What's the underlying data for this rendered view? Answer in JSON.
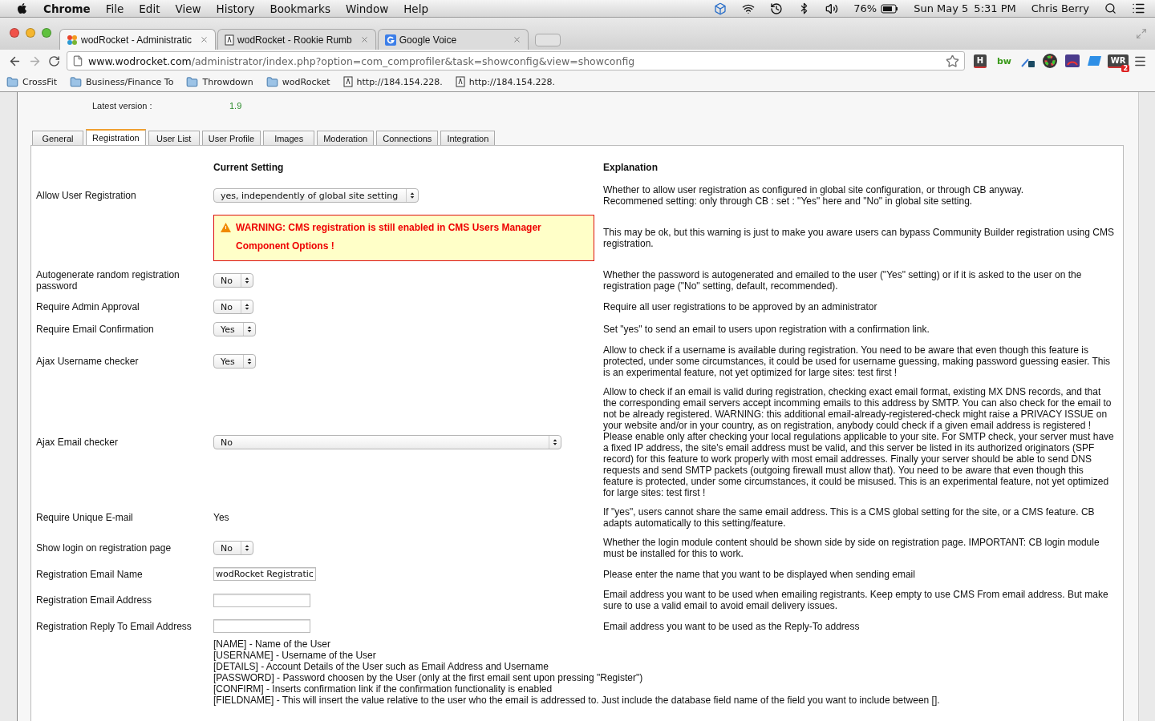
{
  "menubar": {
    "app": "Chrome",
    "menus": [
      "File",
      "Edit",
      "View",
      "History",
      "Bookmarks",
      "Window",
      "Help"
    ],
    "battery": "76%",
    "date": "Sun May 5",
    "time": "5:31 PM",
    "user": "Chris Berry"
  },
  "browser_tabs": [
    {
      "title": "wodRocket - Administratic",
      "selected": true,
      "kind": "pinwheel"
    },
    {
      "title": "wodRocket - Rookie Rumb",
      "selected": false,
      "kind": "page"
    },
    {
      "title": "Google Voice",
      "selected": false,
      "kind": "g"
    }
  ],
  "address_bar": {
    "host": "www.wodrocket.com",
    "path": "/administrator/index.php?option=com_comprofiler&task=showconfig&view=showconfig"
  },
  "extensions": [
    {
      "kind": "tile",
      "label": "H"
    },
    {
      "kind": "word",
      "label": "bw"
    },
    {
      "kind": "dropper"
    },
    {
      "kind": "ring"
    },
    {
      "kind": "gauge"
    },
    {
      "kind": "tag"
    },
    {
      "kind": "tile",
      "label": "WR",
      "badge": "2"
    }
  ],
  "bookmarks": [
    {
      "label": "CrossFit",
      "kind": "folder"
    },
    {
      "label": "Business/Finance To",
      "kind": "folder"
    },
    {
      "label": "Throwdown",
      "kind": "folder"
    },
    {
      "label": "wodRocket",
      "kind": "folder"
    },
    {
      "label": "http://184.154.228.",
      "kind": "page"
    },
    {
      "label": "http://184.154.228.",
      "kind": "page"
    }
  ],
  "version": {
    "label": "Latest version :",
    "value": "1.9"
  },
  "config_tabs": [
    {
      "label": "General",
      "selected": false
    },
    {
      "label": "Registration",
      "selected": true
    },
    {
      "label": "User List",
      "selected": false
    },
    {
      "label": "User Profile",
      "selected": false
    },
    {
      "label": "Images",
      "selected": false
    },
    {
      "label": "Moderation",
      "selected": false
    },
    {
      "label": "Connections",
      "selected": false
    },
    {
      "label": "Integration",
      "selected": false
    }
  ],
  "headings": {
    "setting": "Current Setting",
    "explanation": "Explanation"
  },
  "rows": [
    {
      "label": "Allow User Registration",
      "kind": "select",
      "value": "yes, independently of global site setting",
      "explanation": "Whether to allow user registration as configured in global site configuration, or through CB anyway.\nRecommened setting: only through CB : set : \"Yes\" here and \"No\" in global site setting."
    },
    {
      "kind": "warning",
      "value": "WARNING: CMS registration is still enabled in CMS Users Manager Component Options !",
      "explanation": "This may be ok, but this warning is just to make you aware users can bypass Community Builder registration using CMS registration."
    },
    {
      "label": "Autogenerate random registration password",
      "kind": "select",
      "value": "No",
      "explanation": "Whether the password is autogenerated and emailed to the user (\"Yes\" setting) or if it is asked to the user on the registration page (\"No\" setting, default, recommended)."
    },
    {
      "label": "Require Admin Approval",
      "kind": "select",
      "value": "No",
      "explanation": "Require all user registrations to be approved by an administrator"
    },
    {
      "label": "Require Email Confirmation",
      "kind": "select",
      "value": "Yes",
      "explanation": "Set \"yes\" to send an email to users upon registration with a confirmation link."
    },
    {
      "label": "Ajax Username checker",
      "kind": "select",
      "value": "Yes",
      "explanation": "Allow to check if a username is available during registration. You need to be aware that even though this feature is protected, under some circumstances, it could be used for username guessing, making password guessing easier. This is an experimental feature, not yet optimized for large sites: test first !"
    },
    {
      "label": "Ajax Email checker",
      "kind": "wide_select",
      "value": "No",
      "explanation": "Allow to check if an email is valid during registration, checking exact email format, existing MX DNS records, and that the corresponding email servers accept incomming emails to this address by SMTP. You can also check for the email to not be already registered. WARNING: this additional email-already-registered-check might raise a PRIVACY ISSUE on your website and/or in your country, as on registration, anybody could check if a given email address is registered ! Please enable only after checking your local regulations applicable to your site. For SMTP check, your server must have a fixed IP address, the site's email address must be valid, and this server be listed in its authorized originators (SPF record) for this feature to work properly with most email addresses. Finally your server should be able to send DNS requests and send SMTP packets (outgoing firewall must allow that). You need to be aware that even though this feature is protected, under some circumstances, it could be misused. This is an experimental feature, not yet optimized for large sites: test first !"
    },
    {
      "label": "Require Unique E-mail",
      "kind": "value",
      "value": "Yes",
      "explanation": "If \"yes\", users cannot share the same email address. This is a CMS global setting for the site, or a CMS feature. CB adapts automatically to this setting/feature."
    },
    {
      "label": "Show login on registration page",
      "kind": "select",
      "value": "No",
      "explanation": "Whether the login module content should be shown side by side on registration page. IMPORTANT: CB login module must be installed for this to work."
    },
    {
      "label": "Registration Email Name",
      "kind": "input",
      "value": "wodRocket Registratic",
      "explanation": "Please enter the name that you want to be displayed when sending email"
    },
    {
      "label": "Registration Email Address",
      "kind": "input",
      "explanation": "Email address you want to be used when emailing registrants. Keep empty to use CMS From email address. But make sure to use a valid email to avoid email delivery issues."
    },
    {
      "label": "Registration Reply To Email Address",
      "kind": "input",
      "explanation": "Email address you want to be used as the Reply-To address"
    }
  ],
  "placeholders": [
    "[NAME] - Name of the User",
    "[USERNAME] - Username of the User",
    "[DETAILS] - Account Details of the User such as Email Address and Username",
    "[PASSWORD] - Password choosen by the User (only at the first email sent upon pressing \"Register\")",
    "[CONFIRM] - Inserts confirmation link if the confirmation functionality is enabled",
    "[FIELDNAME] - This will insert the value relative to the user who the email is addressed to. Just include the database field name of the field you want to include between []."
  ]
}
